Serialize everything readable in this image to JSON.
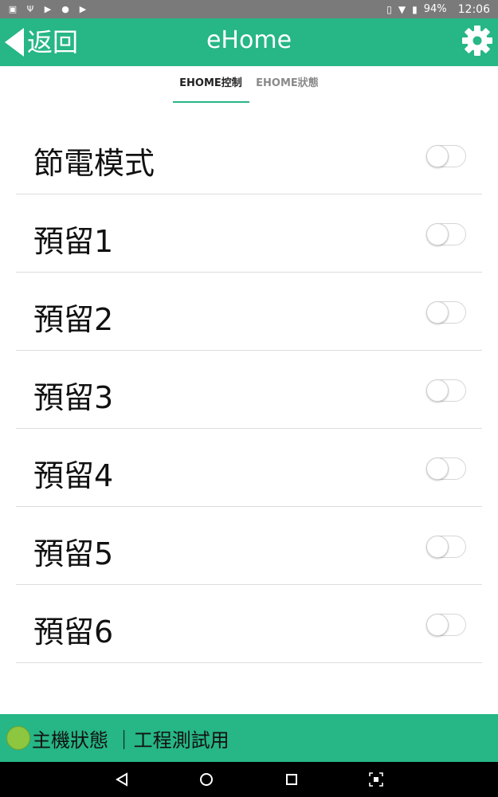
{
  "status_bar": {
    "battery": "94%",
    "time": "12:06"
  },
  "app_bar": {
    "back_label": "返回",
    "title": "eHome"
  },
  "tabs": [
    {
      "label": "EHOME控制",
      "active": true
    },
    {
      "label": "EHOME狀態",
      "active": false
    }
  ],
  "rows": [
    {
      "label": "節電模式",
      "on": false
    },
    {
      "label": "預留1",
      "on": false
    },
    {
      "label": "預留2",
      "on": false
    },
    {
      "label": "預留3",
      "on": false
    },
    {
      "label": "預留4",
      "on": false
    },
    {
      "label": "預留5",
      "on": false
    },
    {
      "label": "預留6",
      "on": false
    }
  ],
  "footer": {
    "text": "主機狀態 ｜工程測試用",
    "indicator_color": "#8dc63f"
  },
  "colors": {
    "accent": "#27b686"
  }
}
